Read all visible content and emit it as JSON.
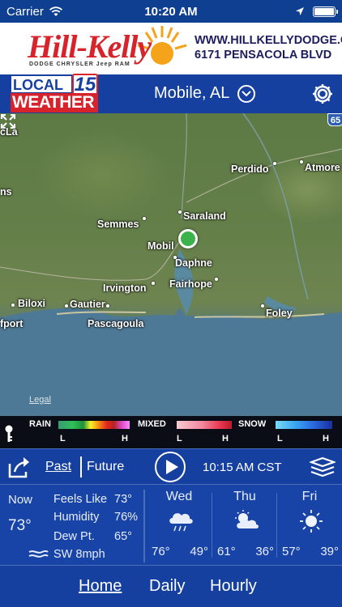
{
  "status_bar": {
    "carrier": "Carrier",
    "time": "10:20 AM"
  },
  "ad": {
    "brand": "Hill-Kelly",
    "makes": "DODGE  CHRYSLER  Jeep  RAM",
    "website": "WWW.HILLKELLYDODGE.COM",
    "address": "6171 PENSACOLA BLVD"
  },
  "header": {
    "logo_local": "LOCAL",
    "logo_number": "15",
    "logo_weather": "WEATHER",
    "location": "Mobile, AL"
  },
  "map": {
    "highway_shield": "65",
    "legal": "Legal",
    "cities": [
      {
        "name": "Perdido"
      },
      {
        "name": "Atmore"
      },
      {
        "name": "Saraland"
      },
      {
        "name": "Semmes"
      },
      {
        "name": "Mobil"
      },
      {
        "name": "Daphne"
      },
      {
        "name": "Irvington"
      },
      {
        "name": "Fairhope"
      },
      {
        "name": "Biloxi"
      },
      {
        "name": "Gautier"
      },
      {
        "name": "Pascagoula"
      },
      {
        "name": "Foley"
      },
      {
        "name": "fport"
      },
      {
        "name": "ns"
      },
      {
        "name": "cLa"
      }
    ]
  },
  "legend": {
    "rain": "RAIN",
    "mixed": "MIXED",
    "snow": "SNOW",
    "low": "L",
    "high": "H"
  },
  "controls": {
    "past": "Past",
    "future": "Future",
    "timestamp": "10:15 AM CST"
  },
  "current": {
    "now_label": "Now",
    "now_temp": "73°",
    "feels_like_label": "Feels Like",
    "feels_like_value": "73°",
    "humidity_label": "Humidity",
    "humidity_value": "76%",
    "dew_point_label": "Dew Pt.",
    "dew_point_value": "65°",
    "wind": "SW 8mph"
  },
  "forecast": [
    {
      "day": "Wed",
      "icon": "rain-cloud-icon",
      "high": "76°",
      "low": "49°"
    },
    {
      "day": "Thu",
      "icon": "partly-cloudy-icon",
      "high": "61°",
      "low": "36°"
    },
    {
      "day": "Fri",
      "icon": "sunny-icon",
      "high": "57°",
      "low": "39°"
    }
  ],
  "tabs": [
    {
      "label": "Home",
      "active": true
    },
    {
      "label": "Daily",
      "active": false
    },
    {
      "label": "Hourly",
      "active": false
    }
  ],
  "colors": {
    "header_blue": "#1540a0",
    "brand_red": "#d7232b",
    "location_dot": "#3cb34a"
  }
}
